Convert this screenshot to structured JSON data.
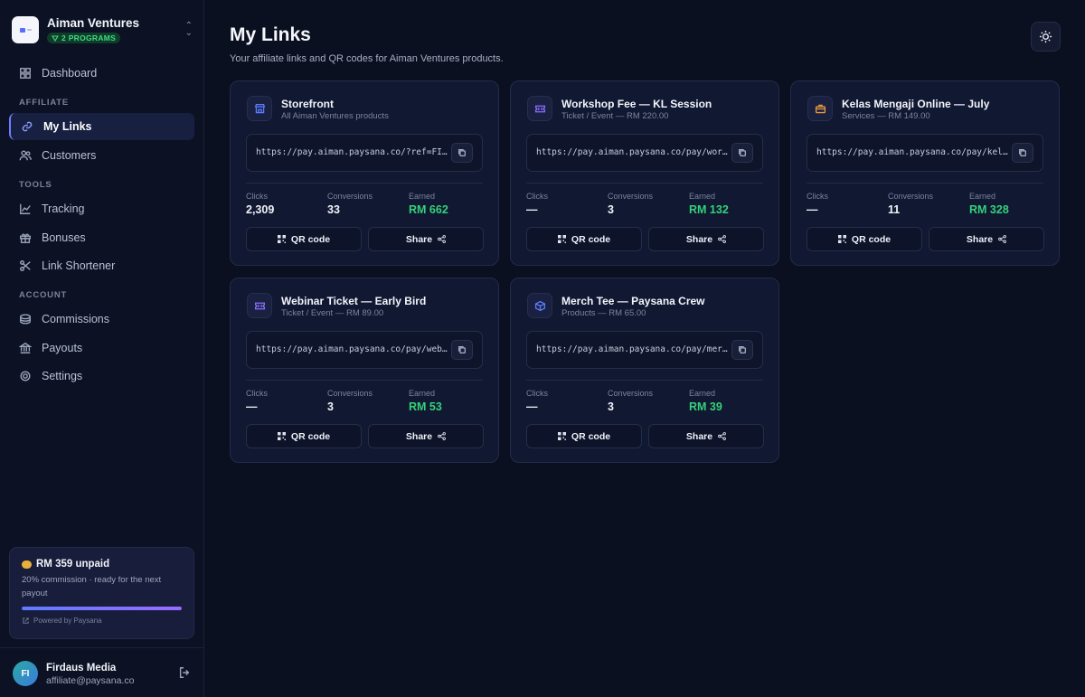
{
  "org": {
    "name": "Aiman Ventures",
    "badge": "2 PROGRAMS"
  },
  "nav": {
    "dashboard": "Dashboard",
    "section_affiliate": "AFFILIATE",
    "my_links": "My Links",
    "customers": "Customers",
    "section_tools": "TOOLS",
    "tracking": "Tracking",
    "bonuses": "Bonuses",
    "link_shortener": "Link Shortener",
    "section_account": "ACCOUNT",
    "commissions": "Commissions",
    "payouts": "Payouts",
    "settings": "Settings"
  },
  "unpaid": {
    "title": "RM 359 unpaid",
    "subtitle": "20% commission · ready for the next payout",
    "progress": 1.0,
    "powered_by": "Powered by Paysana"
  },
  "user": {
    "initials": "FI",
    "name": "Firdaus Media",
    "email": "affiliate@paysana.co"
  },
  "page": {
    "title": "My Links",
    "subtitle": "Your affiliate links and QR codes for Aiman Ventures products."
  },
  "labels": {
    "clicks": "Clicks",
    "conversions": "Conversions",
    "earned": "Earned",
    "qr": "QR code",
    "share": "Share"
  },
  "cards": [
    {
      "title": "Storefront",
      "subtitle": "All Aiman Ventures products",
      "url": "https://pay.aiman.paysana.co/?ref=FIRDAUS",
      "clicks": "2,309",
      "conversions": "33",
      "earned": "RM 662",
      "icon": "store-icon",
      "icon_color": "#5b7cff"
    },
    {
      "title": "Workshop Fee — KL Session",
      "subtitle": "Ticket / Event — RM 220.00",
      "url": "https://pay.aiman.paysana.co/pay/workshop-fee",
      "clicks": "—",
      "conversions": "3",
      "earned": "RM 132",
      "icon": "ticket-icon",
      "icon_color": "#8b6cff"
    },
    {
      "title": "Kelas Mengaji Online — July",
      "subtitle": "Services — RM 149.00",
      "url": "https://pay.aiman.paysana.co/pay/kelas-mengaji",
      "clicks": "—",
      "conversions": "11",
      "earned": "RM 328",
      "icon": "briefcase-icon",
      "icon_color": "#e79a3c"
    },
    {
      "title": "Webinar Ticket — Early Bird",
      "subtitle": "Ticket / Event — RM 89.00",
      "url": "https://pay.aiman.paysana.co/pay/webinar-ticket",
      "clicks": "—",
      "conversions": "3",
      "earned": "RM 53",
      "icon": "ticket-icon",
      "icon_color": "#8b6cff"
    },
    {
      "title": "Merch Tee — Paysana Crew",
      "subtitle": "Products — RM 65.00",
      "url": "https://pay.aiman.paysana.co/pay/merch-tee",
      "clicks": "—",
      "conversions": "3",
      "earned": "RM 39",
      "icon": "box-icon",
      "icon_color": "#5b7cff"
    }
  ]
}
